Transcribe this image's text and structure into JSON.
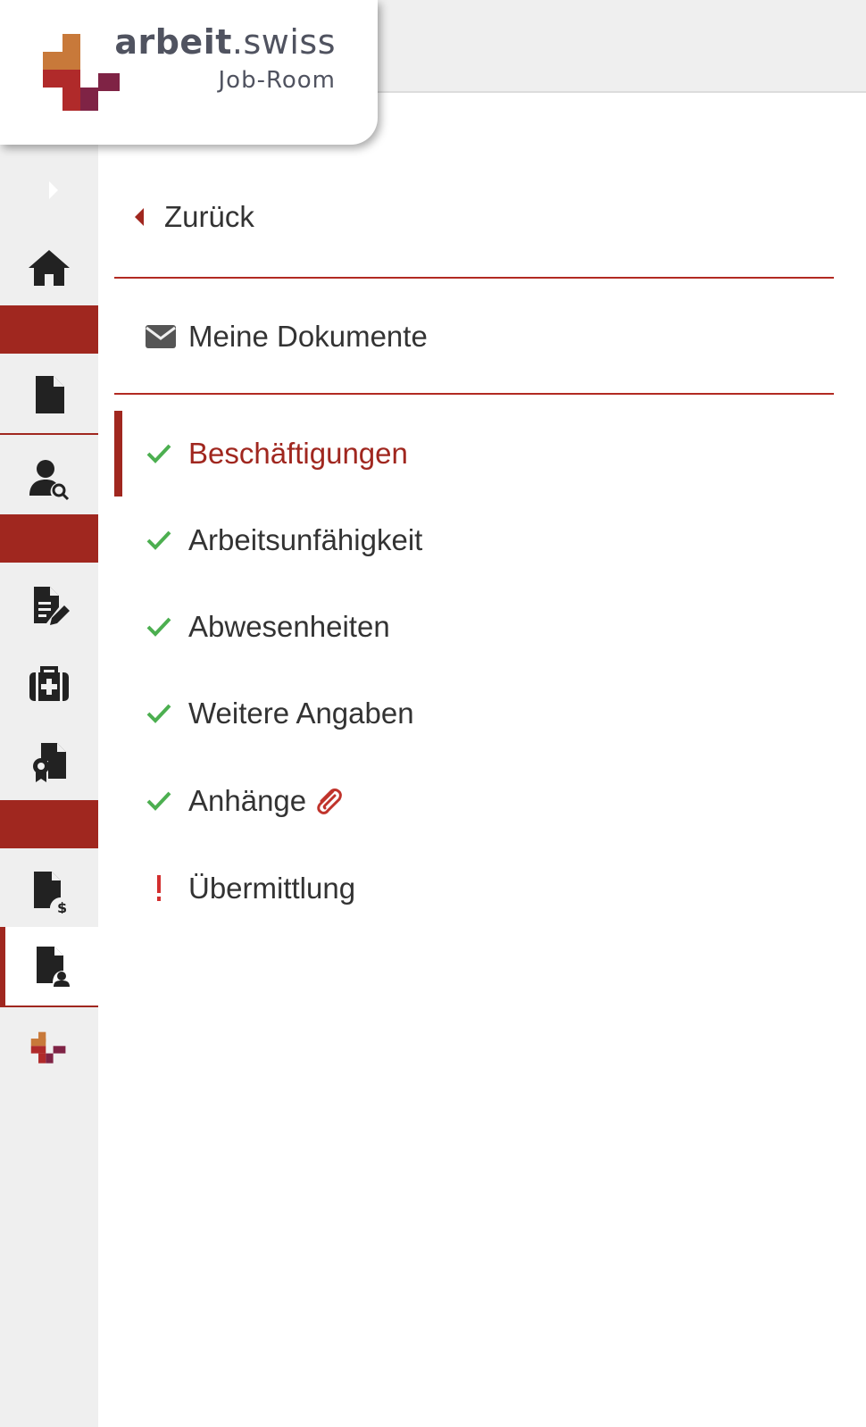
{
  "brand": {
    "name_bold": "arbeit",
    "name_rest": ".swiss",
    "subtitle": "Job-Room",
    "colors": {
      "orange": "#c8793a",
      "red": "#b02a2a",
      "plum": "#7f2345"
    }
  },
  "sidebar": {
    "toggle_icon": "caret-right-icon",
    "items": [
      {
        "name": "home",
        "icon": "home-icon"
      },
      {
        "name": "documents",
        "icon": "file-icon"
      },
      {
        "name": "job-search",
        "icon": "user-search-icon"
      },
      {
        "name": "applications",
        "icon": "file-edit-icon"
      },
      {
        "name": "health",
        "icon": "medical-kit-icon"
      },
      {
        "name": "certificates",
        "icon": "file-certificate-icon"
      },
      {
        "name": "benefits",
        "icon": "file-dollar-icon"
      },
      {
        "name": "personal-file",
        "icon": "file-user-icon"
      },
      {
        "name": "arbeit-swiss",
        "icon": "arbeit-swiss-logo-icon"
      }
    ],
    "accent_color": "#a0271f"
  },
  "nav": {
    "back_label": "Zurück",
    "documents_label": "Meine Dokumente",
    "steps": [
      {
        "label": "Beschäftigungen",
        "status": "done",
        "current": true
      },
      {
        "label": "Arbeitsunfähigkeit",
        "status": "done",
        "current": false
      },
      {
        "label": "Abwesenheiten",
        "status": "done",
        "current": false
      },
      {
        "label": "Weitere Angaben",
        "status": "done",
        "current": false
      },
      {
        "label": "Anhänge",
        "status": "done",
        "current": false,
        "icon": "paperclip-icon"
      },
      {
        "label": "Übermittlung",
        "status": "warning",
        "current": false
      }
    ],
    "colors": {
      "check": "#4caf50",
      "warning": "#d32f2f",
      "divider": "#b22a22"
    }
  }
}
